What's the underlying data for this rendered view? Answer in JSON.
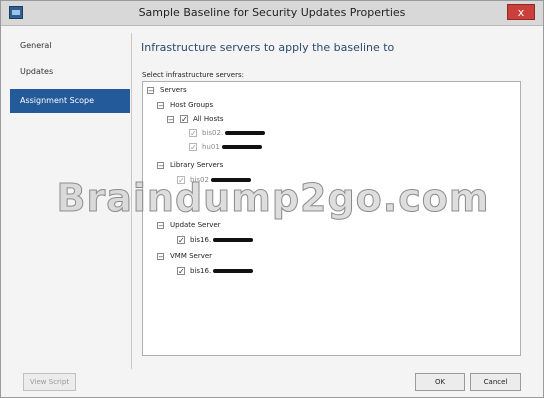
{
  "window": {
    "title": "Sample Baseline for Security Updates Properties",
    "close_label": "x"
  },
  "sidebar": {
    "items": [
      {
        "label": "General"
      },
      {
        "label": "Updates"
      },
      {
        "label": "Assignment Scope"
      }
    ]
  },
  "main": {
    "heading": "Infrastructure servers to apply the baseline to",
    "select_label": "Select infrastructure servers:",
    "tree": {
      "servers": "Servers",
      "host_groups": "Host Groups",
      "all_hosts": "All Hosts",
      "host_1": "bis02.",
      "host_2": "hu01",
      "library_servers": "Library Servers",
      "library_1": "bis02",
      "update_server": "Update Server",
      "update_1": "bis16.",
      "vmm_server": "VMM Server",
      "vmm_1": "bis16."
    }
  },
  "footer": {
    "view_script": "View Script",
    "ok": "OK",
    "cancel": "Cancel"
  },
  "watermark": "Braindump2go.com"
}
